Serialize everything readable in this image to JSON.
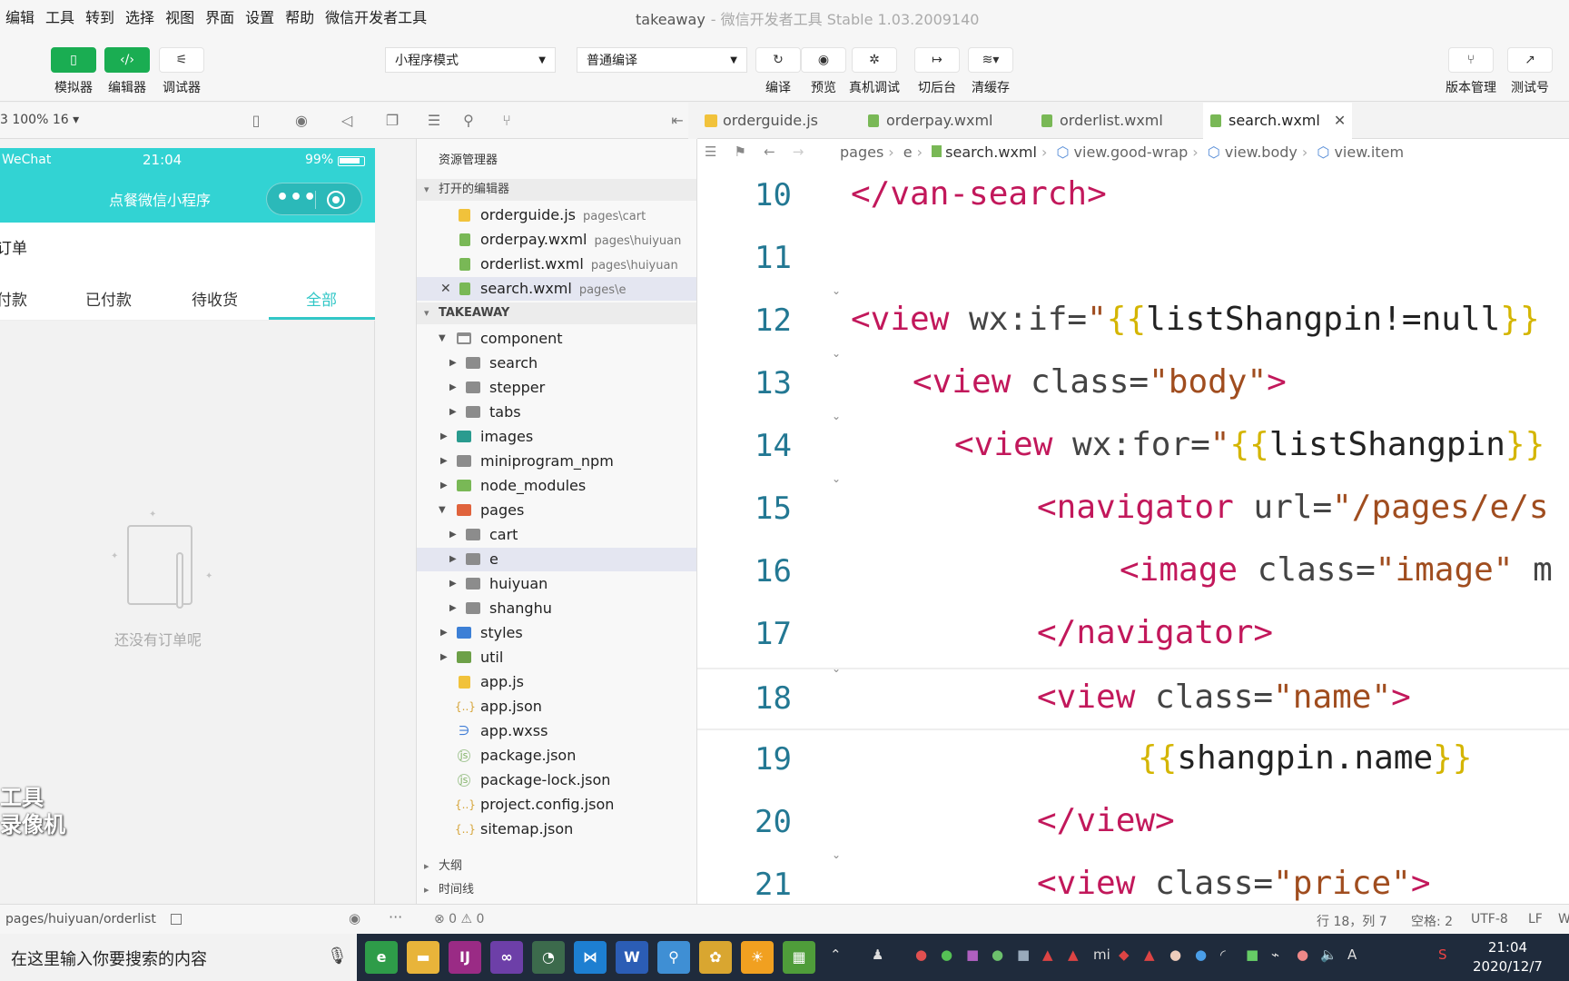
{
  "menubar": {
    "items": [
      "编辑",
      "工具",
      "转到",
      "选择",
      "视图",
      "界面",
      "设置",
      "帮助",
      "微信开发者工具"
    ],
    "title": "takeaway",
    "subtitle": "- 微信开发者工具 Stable 1.03.2009140"
  },
  "toolbar": {
    "simulator": "模拟器",
    "editor": "编辑器",
    "debugger": "调试器",
    "mode_select": "小程序模式",
    "compile_select": "普通编译",
    "compile": "编译",
    "preview": "预览",
    "remote_debug": "真机调试",
    "background": "切后台",
    "clear_cache": "清缓存",
    "version_mgmt": "版本管理",
    "test_account": "测试号"
  },
  "sim_toolbar": {
    "zoom": "3 100% 16 ▾"
  },
  "phone": {
    "carrier": "WeChat",
    "time": "21:04",
    "battery": "99%",
    "nav_title": "点餐微信小程序",
    "page_head": "订单",
    "tabs": [
      "付款",
      "已付款",
      "待收货",
      "全部"
    ],
    "active_tab": "全部",
    "empty_text": "还没有订单呢",
    "watermark_line1": "工具",
    "watermark_line2": "录像机"
  },
  "explorer": {
    "title": "资源管理器",
    "open_editors_label": "打开的编辑器",
    "open_editors": [
      {
        "name": "orderguide.js",
        "path": "pages\\cart"
      },
      {
        "name": "orderpay.wxml",
        "path": "pages\\huiyuan"
      },
      {
        "name": "orderlist.wxml",
        "path": "pages\\huiyuan"
      },
      {
        "name": "search.wxml",
        "path": "pages\\e"
      }
    ],
    "project_label": "TAKEAWAY",
    "tree": [
      "component",
      "search",
      "stepper",
      "tabs",
      "images",
      "miniprogram_npm",
      "node_modules",
      "pages",
      "cart",
      "e",
      "huiyuan",
      "shanghu",
      "styles",
      "util",
      "app.js",
      "app.json",
      "app.wxss",
      "package.json",
      "package-lock.json",
      "project.config.json",
      "sitemap.json"
    ],
    "outline_label": "大纲",
    "timeline_label": "时间线"
  },
  "editor": {
    "tabs": [
      "orderguide.js",
      "orderpay.wxml",
      "orderlist.wxml",
      "search.wxml"
    ],
    "active_tab": "search.wxml",
    "breadcrumb": [
      "pages",
      "e",
      "search.wxml",
      "view.good-wrap",
      "view.body",
      "view.item"
    ],
    "line_numbers": [
      "10",
      "11",
      "12",
      "13",
      "14",
      "15",
      "16",
      "17",
      "18",
      "19",
      "20",
      "21"
    ],
    "code": {
      "l10": "</van-search>",
      "l12a": "<view",
      "l12b": " wx:if=",
      "l12c": "\"",
      "l12d": "{{",
      "l12e": "listShangpin!=null",
      "l12f": "}}",
      "l13a": "<view",
      "l13b": " class=",
      "l13c": "\"body\"",
      "l13d": ">",
      "l14a": "<view",
      "l14b": " wx:for=",
      "l14c": "\"",
      "l14d": "{{",
      "l14e": "listShangpin",
      "l14f": "}}",
      "l15a": "<navigator",
      "l15b": " url=",
      "l15c": "\"/pages/e/s",
      "l16a": "<image",
      "l16b": " class=",
      "l16c": "\"image\"",
      "l16d": " m",
      "l17": "</navigator>",
      "l18a": "<view",
      "l18b": " class=",
      "l18c": "\"name\"",
      "l18d": ">",
      "l19a": "{{",
      "l19b": "shangpin.name",
      "l19c": "}}",
      "l20": "</view>",
      "l21a": "<view",
      "l21b": " class=",
      "l21c": "\"price\"",
      "l21d": ">"
    }
  },
  "status": {
    "page_path": "pages/huiyuan/orderlist",
    "errors": "⊗ 0 ⚠ 0",
    "cursor": "行 18，列 7",
    "spaces": "空格: 2",
    "encoding": "UTF-8",
    "eol": "LF",
    "lang": "W"
  },
  "taskbar": {
    "search_placeholder": "在这里输入你要搜索的内容",
    "time": "21:04",
    "date": "2020/12/7"
  },
  "colors": {
    "accent_green": "#1aad52",
    "phone_teal": "#32d3d3"
  }
}
